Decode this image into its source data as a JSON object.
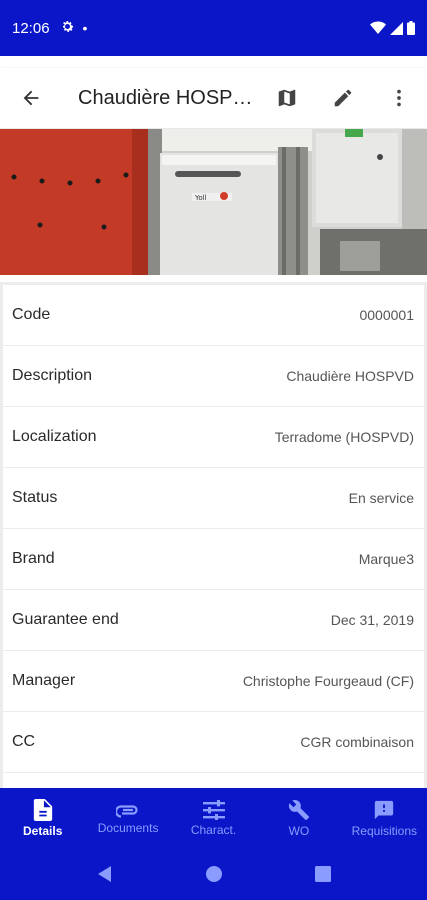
{
  "status_bar": {
    "time": "12:06",
    "dot": "•"
  },
  "header": {
    "title": "Chaudière HOSPVD"
  },
  "details": [
    {
      "label": "Code",
      "value": "0000001"
    },
    {
      "label": "Description",
      "value": "Chaudière HOSPVD"
    },
    {
      "label": "Localization",
      "value": "Terradome (HOSPVD)"
    },
    {
      "label": "Status",
      "value": "En service"
    },
    {
      "label": "Brand",
      "value": "Marque3"
    },
    {
      "label": "Guarantee end",
      "value": "Dec 31, 2019"
    },
    {
      "label": "Manager",
      "value": "Christophe Fourgeaud (CF)"
    },
    {
      "label": "CC",
      "value": "CGR combinaison"
    }
  ],
  "bottom_nav": [
    {
      "label": "Details",
      "icon": "document-icon",
      "active": true
    },
    {
      "label": "Documents",
      "icon": "paperclip-icon",
      "active": false
    },
    {
      "label": "Charact.",
      "icon": "sliders-icon",
      "active": false
    },
    {
      "label": "WO",
      "icon": "wrench-icon",
      "active": false
    },
    {
      "label": "Requisitions",
      "icon": "message-alert-icon",
      "active": false
    }
  ],
  "colors": {
    "primary": "#0a16c8",
    "nav_inactive": "#8a9cff"
  }
}
